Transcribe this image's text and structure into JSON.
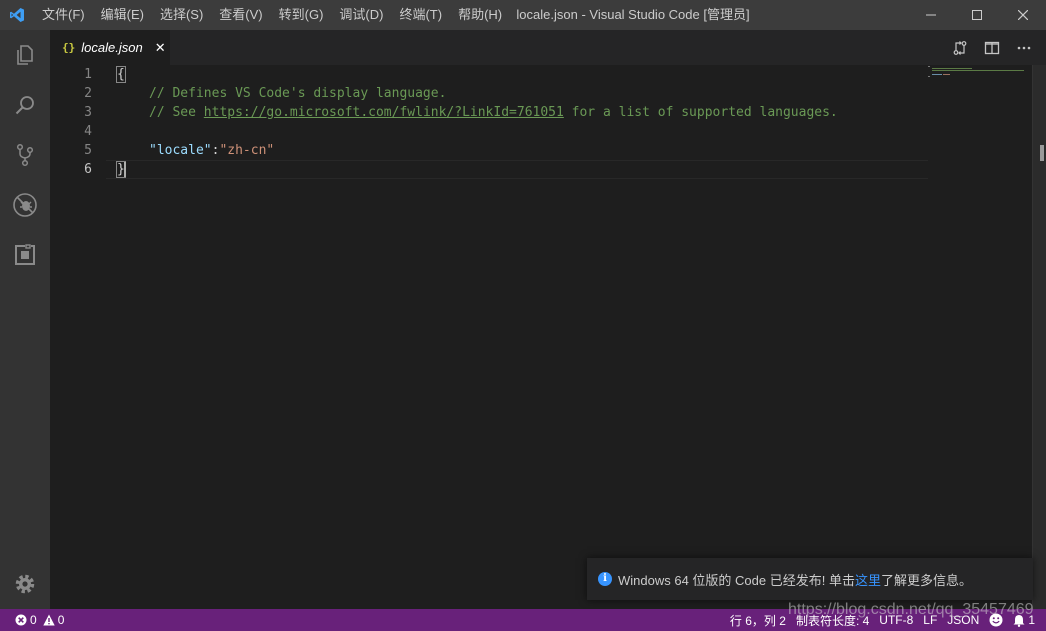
{
  "window": {
    "title": "locale.json - Visual Studio Code [管理员]"
  },
  "menu": [
    "文件(F)",
    "编辑(E)",
    "选择(S)",
    "查看(V)",
    "转到(G)",
    "调试(D)",
    "终端(T)",
    "帮助(H)"
  ],
  "activity": [
    "explorer-icon",
    "search-icon",
    "source-control-icon",
    "debug-icon",
    "extensions-icon",
    "gear-icon"
  ],
  "tab": {
    "icon": "{}",
    "label": "locale.json",
    "close": "✕"
  },
  "editor": {
    "line_numbers": [
      "1",
      "2",
      "3",
      "4",
      "5",
      "6"
    ],
    "lines": {
      "l1": "{",
      "l2": "// Defines VS Code's display language.",
      "l3_prefix": "// See ",
      "l3_link": "https://go.microsoft.com/fwlink/?LinkId=761051",
      "l3_suffix": " for a list of supported languages.",
      "l5_key": "\"locale\"",
      "l5_colon": ":",
      "l5_value": "\"zh-cn\"",
      "l6": "}"
    },
    "active_line": "6"
  },
  "notification": {
    "text": "Windows 64 位版的 Code 已经发布! 单击",
    "link": "这里",
    "suffix": "了解更多信息。"
  },
  "statusbar": {
    "errors": "0",
    "warnings": "0",
    "position": "行 6，列 2",
    "tab_size": "制表符长度: 4",
    "encoding": "UTF-8",
    "eol": "LF",
    "language": "JSON",
    "notifications": "1"
  },
  "watermark": "https://blog.csdn.net/qq_35457469",
  "colors": {
    "statusbar": "#68217a",
    "accent": "#3794ff",
    "comment": "#6a9955",
    "key": "#9cdcfe",
    "string": "#ce9178"
  }
}
